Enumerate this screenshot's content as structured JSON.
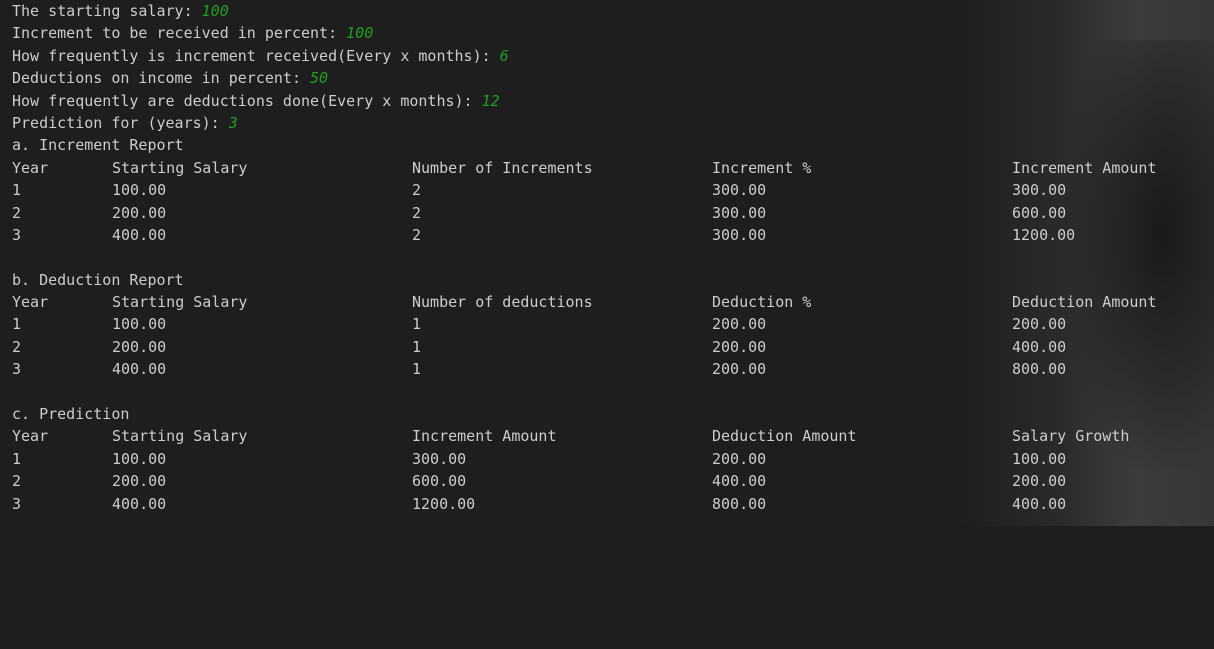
{
  "inputs": [
    {
      "label": "The starting salary: ",
      "value": "100"
    },
    {
      "label": "Increment to be received in percent: ",
      "value": "100"
    },
    {
      "label": "How frequently is increment received(Every x months): ",
      "value": "6"
    },
    {
      "label": "Deductions on income in percent: ",
      "value": "50"
    },
    {
      "label": "How frequently are deductions done(Every x months): ",
      "value": "12"
    },
    {
      "label": "Prediction for (years): ",
      "value": "3"
    }
  ],
  "increment_report": {
    "title": "a. Increment Report",
    "headers": [
      "Year",
      "Starting Salary",
      "Number of Increments",
      "Increment %",
      "Increment Amount"
    ],
    "rows": [
      [
        "1",
        "100.00",
        "2",
        "300.00",
        "300.00"
      ],
      [
        "2",
        "200.00",
        "2",
        "300.00",
        "600.00"
      ],
      [
        "3",
        "400.00",
        "2",
        "300.00",
        "1200.00"
      ]
    ]
  },
  "deduction_report": {
    "title": "b. Deduction Report",
    "headers": [
      "Year",
      "Starting Salary",
      "Number of deductions",
      "Deduction %",
      "Deduction Amount"
    ],
    "rows": [
      [
        "1",
        "100.00",
        "1",
        "200.00",
        "200.00"
      ],
      [
        "2",
        "200.00",
        "1",
        "200.00",
        "400.00"
      ],
      [
        "3",
        "400.00",
        "1",
        "200.00",
        "800.00"
      ]
    ]
  },
  "prediction": {
    "title": "c. Prediction",
    "headers": [
      "Year",
      "Starting Salary",
      "Increment Amount",
      "Deduction Amount",
      "Salary Growth"
    ],
    "rows": [
      [
        "1",
        "100.00",
        "300.00",
        "200.00",
        "100.00"
      ],
      [
        "2",
        "200.00",
        "600.00",
        "400.00",
        "200.00"
      ],
      [
        "3",
        "400.00",
        "1200.00",
        "800.00",
        "400.00"
      ]
    ]
  }
}
